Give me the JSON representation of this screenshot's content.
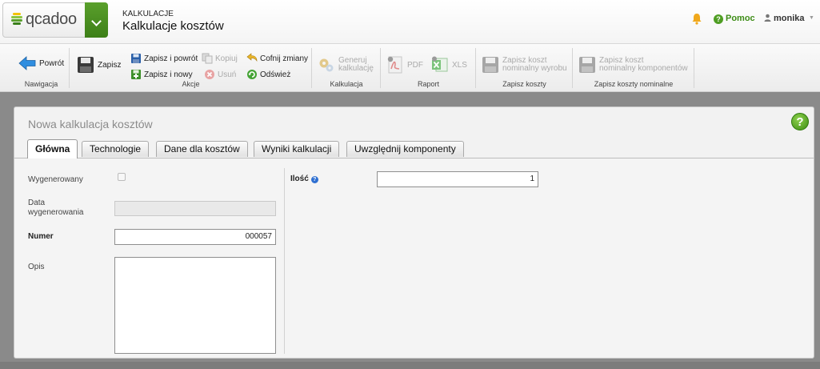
{
  "app": {
    "logo_text": "qcadoo",
    "breadcrumb_small": "KALKULACJE",
    "breadcrumb_title": "Kalkulacje kosztów",
    "help_label": "Pomoc",
    "user_name": "monika"
  },
  "ribbon": {
    "groups": {
      "navigation": "Nawigacja",
      "actions": "Akcje",
      "calculation": "Kalkulacja",
      "report": "Raport",
      "save_costs": "Zapisz koszty",
      "save_nominal_costs": "Zapisz koszty nominalne"
    },
    "back": "Powrót",
    "save": "Zapisz",
    "save_back": "Zapisz i powrót",
    "save_new": "Zapisz i nowy",
    "copy": "Kopiuj",
    "delete": "Usuń",
    "undo": "Cofnij zmiany",
    "refresh": "Odśwież",
    "generate_l1": "Generuj",
    "generate_l2": "kalkulację",
    "pdf": "PDF",
    "xls": "XLS",
    "save_product_cost_l1": "Zapisz koszt",
    "save_product_cost_l2": "nominalny wyrobu",
    "save_components_cost_l1": "Zapisz koszt",
    "save_components_cost_l2": "nominalny komponentów"
  },
  "form": {
    "title": "Nowa kalkulacja kosztów",
    "tabs": [
      "Główna",
      "Technologie",
      "Dane dla kosztów",
      "Wyniki kalkulacji",
      "Uwzględnij komponenty"
    ],
    "generated_label": "Wygenerowany",
    "generation_date_label_l1": "Data",
    "generation_date_label_l2": "wygenerowania",
    "generation_date_value": "",
    "number_label": "Numer",
    "number_value": "000057",
    "description_label": "Opis",
    "description_value": "",
    "quantity_label": "Ilość",
    "quantity_value": "1"
  },
  "colors": {
    "brand_green": "#4f9e23",
    "bell": "#f0a81c",
    "info_blue": "#2e6fd1"
  }
}
